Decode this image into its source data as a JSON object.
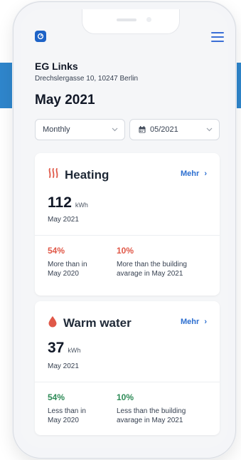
{
  "header": {
    "building_name": "EG Links",
    "address": "Drechslergasse 10, 10247 Berlin",
    "period_title": "May 2021"
  },
  "filters": {
    "interval": "Monthly",
    "date": "05/2021"
  },
  "cards": [
    {
      "title": "Heating",
      "icon": "heating-icon",
      "more_label": "Mehr",
      "value": "112",
      "unit": "kWh",
      "value_period": "May 2021",
      "stats": [
        {
          "percent": "54%",
          "description": "More than in\nMay 2020",
          "color": "#e05848"
        },
        {
          "percent": "10%",
          "description": "More than the building\navarage in May 2021",
          "color": "#e05848"
        }
      ]
    },
    {
      "title": "Warm water",
      "icon": "water-drop-icon",
      "more_label": "Mehr",
      "value": "37",
      "unit": "kWh",
      "value_period": "May 2021",
      "stats": [
        {
          "percent": "54%",
          "description": "Less than in\nMay 2020",
          "color": "#2e8b57"
        },
        {
          "percent": "10%",
          "description": "Less than the building\navarage in May 2021",
          "color": "#2e8b57"
        }
      ]
    }
  ],
  "colors": {
    "accent": "#2d6fd0",
    "background_band": "#2f86cc",
    "negative": "#e05848",
    "positive": "#2e8b57"
  }
}
